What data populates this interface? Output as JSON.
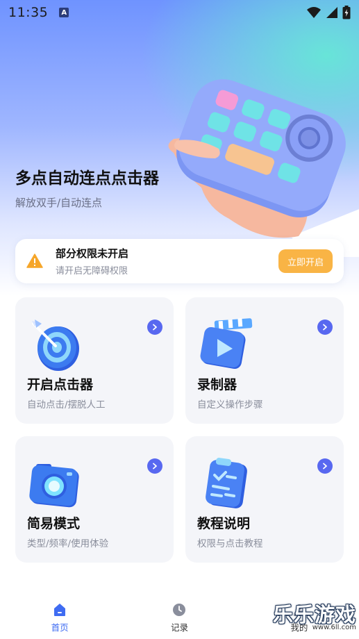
{
  "status_bar": {
    "time": "11:35",
    "notification_badge": "A"
  },
  "hero": {
    "title": "多点自动连点点击器",
    "subtitle": "解放双手/自动连点"
  },
  "permission_card": {
    "title": "部分权限未开启",
    "description": "请开启无障碍权限",
    "button_label": "立即开启"
  },
  "features": [
    {
      "title": "开启点击器",
      "subtitle": "自动点击/摆脱人工",
      "icon": "target-icon"
    },
    {
      "title": "录制器",
      "subtitle": "自定义操作步骤",
      "icon": "video-clapper-icon"
    },
    {
      "title": "简易模式",
      "subtitle": "类型/频率/使用体验",
      "icon": "camera-icon"
    },
    {
      "title": "教程说明",
      "subtitle": "权限与点击教程",
      "icon": "clipboard-icon"
    }
  ],
  "bottom_nav": [
    {
      "label": "首页",
      "icon": "home-icon",
      "active": true
    },
    {
      "label": "记录",
      "icon": "clock-icon",
      "active": false
    },
    {
      "label": "我的",
      "icon": "profile-icon",
      "active": false
    }
  ],
  "watermark": {
    "title": "乐乐游戏",
    "url": "www.6ll.com"
  },
  "colors": {
    "accent": "#3f6cf2",
    "arrow": "#5868f0",
    "warning": "#f9b445",
    "card_bg": "#f4f5f9"
  }
}
